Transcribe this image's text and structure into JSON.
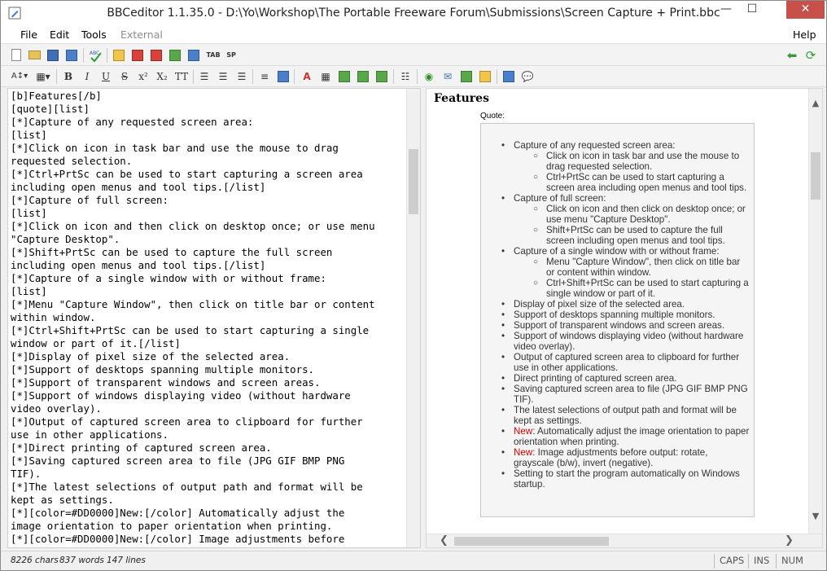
{
  "window": {
    "title": "BBCeditor 1.1.35.0 - D:\\Yo\\Workshop\\The Portable Freeware Forum\\Submissions\\Screen Capture + Print.bbc",
    "min_glyph": "—",
    "max_glyph": "☐",
    "close_glyph": "✕"
  },
  "menu": {
    "file": "File",
    "edit": "Edit",
    "tools": "Tools",
    "external": "External",
    "help": "Help"
  },
  "toolbar1": {
    "tab_label": "TAB",
    "sp_label": "SP"
  },
  "toolbar2": {
    "bold": "B",
    "italic": "I",
    "underline": "U",
    "strike": "S",
    "superscript": "x²",
    "subscript": "X₂",
    "teletype": "TT"
  },
  "editor": {
    "lines": [
      "[b]Features[/b]",
      "[quote][list]",
      "[*]Capture of any requested screen area:",
      "[list]",
      "[*]Click on icon in task bar and use the mouse to drag",
      "requested selection.",
      "[*]Ctrl+PrtSc can be used to start capturing a screen area",
      "including open menus and tool tips.[/list]",
      "[*]Capture of full screen:",
      "[list]",
      "[*]Click on icon and then click on desktop once; or use menu",
      "\"Capture Desktop\".",
      "[*]Shift+PrtSc can be used to capture the full screen",
      "including open menus and tool tips.[/list]",
      "[*]Capture of a single window with or without frame:",
      "[list]",
      "[*]Menu \"Capture Window\", then click on title bar or content",
      "within window.",
      "[*]Ctrl+Shift+PrtSc can be used to start capturing a single",
      "window or part of it.[/list]",
      "[*]Display of pixel size of the selected area.",
      "[*]Support of desktops spanning multiple monitors.",
      "[*]Support of transparent windows and screen areas.",
      "[*]Support of windows displaying video (without hardware",
      "video overlay).",
      "[*]Output of captured screen area to clipboard for further",
      "use in other applications.",
      "[*]Direct printing of captured screen area.",
      "[*]Saving captured screen area to file (JPG GIF BMP PNG",
      "TIF).",
      "[*]The latest selections of output path and format will be",
      "kept as settings.",
      "[*][color=#DD0000]New:[/color] Automatically adjust the",
      "image orientation to paper orientation when printing.",
      "[*][color=#DD0000]New:[/color] Image adjustments before"
    ]
  },
  "preview": {
    "heading": "Features",
    "quote_label": "Quote:",
    "bullet": "•",
    "sub_bullet": "○",
    "items": [
      {
        "text": "Capture of any requested screen area:",
        "sub": [
          "Click on icon in task bar and use the mouse to drag requested selection.",
          "Ctrl+PrtSc can be used to start capturing a screen area including open menus and tool tips."
        ]
      },
      {
        "text": "Capture of full screen:",
        "sub": [
          "Click on icon and then click on desktop once; or use menu \"Capture Desktop\".",
          "Shift+PrtSc can be used to capture the full screen including open menus and tool tips."
        ]
      },
      {
        "text": "Capture of a single window with or without frame:",
        "sub": [
          "Menu \"Capture Window\", then click on title bar or content within window.",
          "Ctrl+Shift+PrtSc can be used to start capturing a single window or part of it."
        ]
      },
      {
        "text": "Display of pixel size of the selected area."
      },
      {
        "text": "Support of desktops spanning multiple monitors."
      },
      {
        "text": "Support of transparent windows and screen areas."
      },
      {
        "text": "Support of windows displaying video (without hardware video overlay)."
      },
      {
        "text": "Output of captured screen area to clipboard for further use in other applications."
      },
      {
        "text": "Direct printing of captured screen area."
      },
      {
        "text": "Saving captured screen area to file (JPG GIF BMP PNG TIF)."
      },
      {
        "text": "The latest selections of output path and format will be kept as settings."
      },
      {
        "new_label": "New:",
        "text": " Automatically adjust the image orientation to paper orientation when printing."
      },
      {
        "new_label": "New:",
        "text": " Image adjustments before output: rotate, grayscale (b/w), invert (negative)."
      },
      {
        "text": "Setting to start the program automatically on Windows startup."
      }
    ],
    "new_color": "#DD0000"
  },
  "scroll": {
    "up": "▲",
    "down": "▼",
    "left": "❮",
    "right": "❯"
  },
  "status": {
    "chars": "8226 chars",
    "words": "837 words",
    "lines": "147 lines",
    "caps": "CAPS",
    "ins": "INS",
    "num": "NUM"
  }
}
